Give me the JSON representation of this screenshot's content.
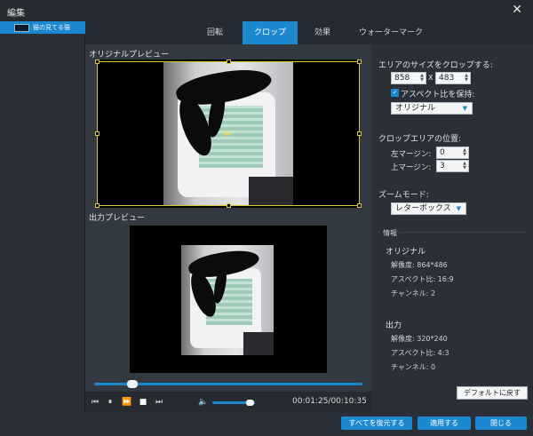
{
  "window": {
    "title": "編集",
    "close_glyph": "✕"
  },
  "sidebar": {
    "file_name": "猫の見てる猫"
  },
  "tabs": [
    {
      "label": "回転",
      "active": false
    },
    {
      "label": "クロップ",
      "active": true
    },
    {
      "label": "効果",
      "active": false
    },
    {
      "label": "ウォーターマーク",
      "active": false
    }
  ],
  "preview": {
    "original_label": "オリジナルプレビュー",
    "output_label": "出力プレビュー"
  },
  "player": {
    "progress": 0.14,
    "volume": 0.8,
    "time": "00:01:25/00:10:35"
  },
  "crop": {
    "area_label": "エリアのサイズをクロップする:",
    "width": "858",
    "separator": "X",
    "height": "483",
    "keep_aspect_label": "アスペクト比を保持:",
    "keep_aspect_checked": true,
    "aspect_value": "オリジナル",
    "position_label": "クロップエリアの位置:",
    "left_margin_label": "左マージン:",
    "left_margin": "0",
    "top_margin_label": "上マージン:",
    "top_margin": "3",
    "zoom_label": "ズームモード:",
    "zoom_value": "レターボックス"
  },
  "info": {
    "heading": "情報",
    "original_heading": "オリジナル",
    "original_resolution": "解像度: 864*486",
    "original_aspect": "アスペクト比: 16:9",
    "original_channels": "チャンネル: 2",
    "output_heading": "出力",
    "output_resolution": "解像度: 320*240",
    "output_aspect": "アスペクト比: 4:3",
    "output_channels": "チャンネル: 0",
    "reset_default": "デフォルトに戻す"
  },
  "footer": {
    "restore_all": "すべてを復元する",
    "apply": "適用する",
    "close": "閉じる"
  },
  "colors": {
    "accent": "#1b88d0",
    "crop_frame": "#d9c63a"
  }
}
